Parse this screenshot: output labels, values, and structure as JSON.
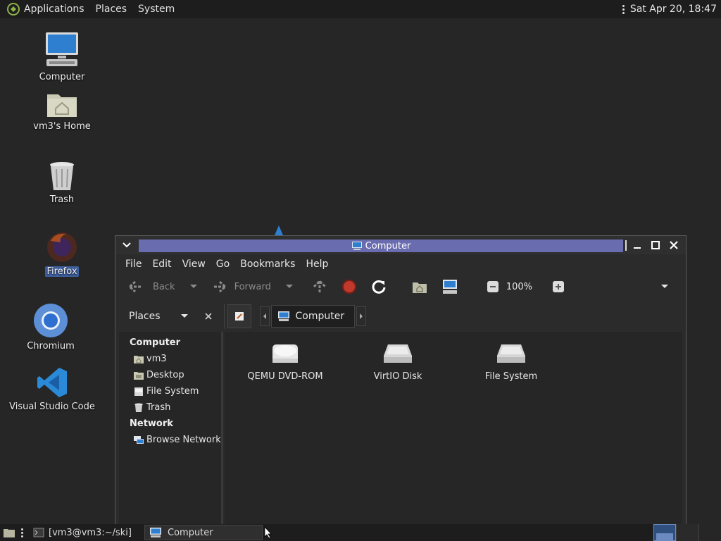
{
  "top_panel": {
    "menus": [
      "Applications",
      "Places",
      "System"
    ],
    "clock": "Sat Apr 20, 18:47"
  },
  "desktop": {
    "icons": [
      {
        "label": "Computer"
      },
      {
        "label": "vm3's Home"
      },
      {
        "label": "Trash"
      },
      {
        "label": "Firefox",
        "selected": true
      },
      {
        "label": "Chromium"
      },
      {
        "label": "Visual Studio Code"
      }
    ]
  },
  "window": {
    "title": "Computer",
    "menus": [
      "File",
      "Edit",
      "View",
      "Go",
      "Bookmarks",
      "Help"
    ],
    "toolbar": {
      "back_label": "Back",
      "forward_label": "Forward",
      "zoom_level": "100%"
    },
    "location": {
      "crumb": "Computer"
    },
    "side_pane": {
      "selector_label": "Places",
      "sections": [
        {
          "header": "Computer",
          "items": [
            "vm3",
            "Desktop",
            "File System",
            "Trash"
          ]
        },
        {
          "header": "Network",
          "items": [
            "Browse Network"
          ]
        }
      ]
    },
    "items": [
      "QEMU DVD-ROM",
      "VirtIO Disk",
      "File System"
    ]
  },
  "bottom_panel": {
    "tasks": [
      "[vm3@vm3:~/ski]",
      "Computer"
    ]
  },
  "colors": {
    "title_active": "#6a6cb0",
    "desktop_bg": "#262626",
    "panel_bg": "#1d1d1d",
    "selection": "#3f5f9e",
    "stop_red": "#c0392b",
    "vscode_blue": "#2a8ad8"
  }
}
